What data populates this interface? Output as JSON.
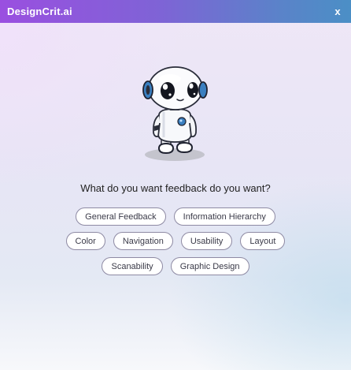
{
  "window": {
    "title": "DesignCrit.ai",
    "close_label": "x"
  },
  "main": {
    "mascot_icon": "robot-mascot-icon",
    "question": "What do you want feedback do you want?",
    "options": [
      "General Feedback",
      "Information Hierarchy",
      "Color",
      "Navigation",
      "Usability",
      "Layout",
      "Scanability",
      "Graphic Design"
    ]
  },
  "colors": {
    "titlebar_start": "#9a4fe0",
    "titlebar_end": "#4b8fc6",
    "chip_border": "#8e8aa3",
    "robot_accent": "#3a7fc0"
  }
}
